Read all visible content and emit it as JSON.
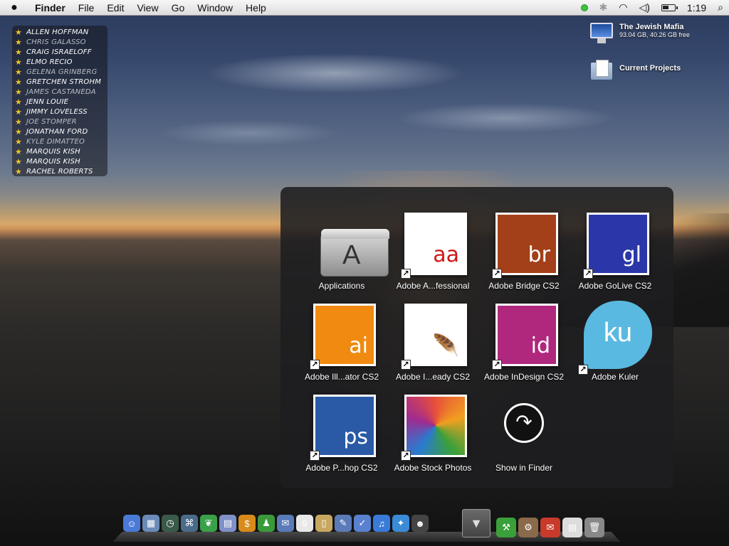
{
  "menubar": {
    "items": [
      "Finder",
      "File",
      "Edit",
      "View",
      "Go",
      "Window",
      "Help"
    ],
    "clock": "1:19"
  },
  "contacts": [
    {
      "name": "ALLEN HOFFMAN",
      "dim": false
    },
    {
      "name": "CHRIS GALASSO",
      "dim": true
    },
    {
      "name": "CRAIG ISRAELOFF",
      "dim": false
    },
    {
      "name": "ELMO RECIO",
      "dim": false
    },
    {
      "name": "GELENA GRINBERG",
      "dim": true
    },
    {
      "name": "GRETCHEN STROHM",
      "dim": false
    },
    {
      "name": "JAMES CASTANEDA",
      "dim": true
    },
    {
      "name": "JENN LOUIE",
      "dim": false
    },
    {
      "name": "JIMMY LOVELESS",
      "dim": false
    },
    {
      "name": "JOE STOMPER",
      "dim": true
    },
    {
      "name": "JONATHAN FORD",
      "dim": false
    },
    {
      "name": "KYLE DIMATTEO",
      "dim": true
    },
    {
      "name": "MARQUIS KISH",
      "dim": false
    },
    {
      "name": "MARQUIS KISH",
      "dim": false
    },
    {
      "name": "RACHEL ROBERTS",
      "dim": false
    }
  ],
  "desktop": {
    "drive": {
      "name": "The Jewish Mafia",
      "info": "93.04 GB, 40.26 GB free"
    },
    "folder": {
      "name": "Current Projects"
    }
  },
  "stack": {
    "tiles": [
      {
        "id": "applications",
        "label": "Applications",
        "kind": "folder",
        "glyph": "A"
      },
      {
        "id": "acrobat",
        "label": "Adobe A...fessional",
        "kind": "art",
        "color": "#ffffff",
        "fg": "#d01818",
        "glyph": "aa",
        "alias": true
      },
      {
        "id": "bridge",
        "label": "Adobe Bridge CS2",
        "kind": "art",
        "color": "#a3401a",
        "glyph": "br",
        "alias": true
      },
      {
        "id": "golive",
        "label": "Adobe GoLive CS2",
        "kind": "art",
        "color": "#2b37a8",
        "glyph": "gl",
        "alias": true
      },
      {
        "id": "illustrator",
        "label": "Adobe Ill...ator CS2",
        "kind": "art",
        "color": "#f08a10",
        "glyph": "ai",
        "alias": true
      },
      {
        "id": "imageready",
        "label": "Adobe I...eady CS2",
        "kind": "art",
        "color": "#ffffff",
        "fg": "#c8360e",
        "glyph": "🪶",
        "alias": true
      },
      {
        "id": "indesign",
        "label": "Adobe InDesign CS2",
        "kind": "art",
        "color": "#b0287e",
        "glyph": "id",
        "alias": true
      },
      {
        "id": "kuler",
        "label": "Adobe Kuler",
        "kind": "kuler",
        "glyph": "ku",
        "alias": true
      },
      {
        "id": "photoshop",
        "label": "Adobe P...hop CS2",
        "kind": "art",
        "color": "#2a5aa6",
        "glyph": "ps",
        "alias": true
      },
      {
        "id": "stock",
        "label": "Adobe Stock Photos",
        "kind": "art",
        "color": "#c8501e",
        "glyph": "",
        "alias": true
      },
      {
        "id": "show-in-finder",
        "label": "Show in Finder",
        "kind": "finder",
        "glyph": "↷",
        "alias": false
      }
    ]
  },
  "dock": {
    "icons": [
      {
        "name": "finder-icon",
        "color": "#4a7ad8",
        "glyph": "☺"
      },
      {
        "name": "dashboard-icon",
        "color": "#6a8ab8",
        "glyph": "▦"
      },
      {
        "name": "time-machine-icon",
        "color": "#3a5a4a",
        "glyph": "◷"
      },
      {
        "name": "spaces-icon",
        "color": "#4a6a8a",
        "glyph": "⌘"
      },
      {
        "name": "leaf-icon",
        "color": "#3aa04a",
        "glyph": "❦"
      },
      {
        "name": "truck-icon",
        "color": "#8090c8",
        "glyph": "▤"
      },
      {
        "name": "dollar-icon",
        "color": "#d88a1a",
        "glyph": "$"
      },
      {
        "name": "buddy-icon",
        "color": "#3a9a3a",
        "glyph": "♟"
      },
      {
        "name": "mail-icon",
        "color": "#5a7ab8",
        "glyph": "✉"
      },
      {
        "name": "calendar-icon",
        "color": "#e8e8e8",
        "glyph": "9"
      },
      {
        "name": "notes-icon",
        "color": "#c8a860",
        "glyph": "▯"
      },
      {
        "name": "preview-icon",
        "color": "#5a7ab8",
        "glyph": "✎"
      },
      {
        "name": "checklist-icon",
        "color": "#5a80d0",
        "glyph": "✓"
      },
      {
        "name": "itunes-icon",
        "color": "#3a7ad8",
        "glyph": "♫"
      },
      {
        "name": "safari-icon",
        "color": "#3a8ad8",
        "glyph": "✦"
      },
      {
        "name": "avatar-icon",
        "color": "#444444",
        "glyph": "☻"
      }
    ],
    "right_icons": [
      {
        "name": "utilities-icon",
        "color": "#3aa03a",
        "glyph": "⚒"
      },
      {
        "name": "system-prefs-icon",
        "color": "#8a6a4a",
        "glyph": "⚙"
      },
      {
        "name": "mailbox-icon",
        "color": "#c83a2a",
        "glyph": "✉"
      },
      {
        "name": "documents-icon",
        "color": "#dddddd",
        "glyph": "▤"
      },
      {
        "name": "trash-icon",
        "color": "#888888",
        "glyph": "🗑"
      }
    ]
  }
}
